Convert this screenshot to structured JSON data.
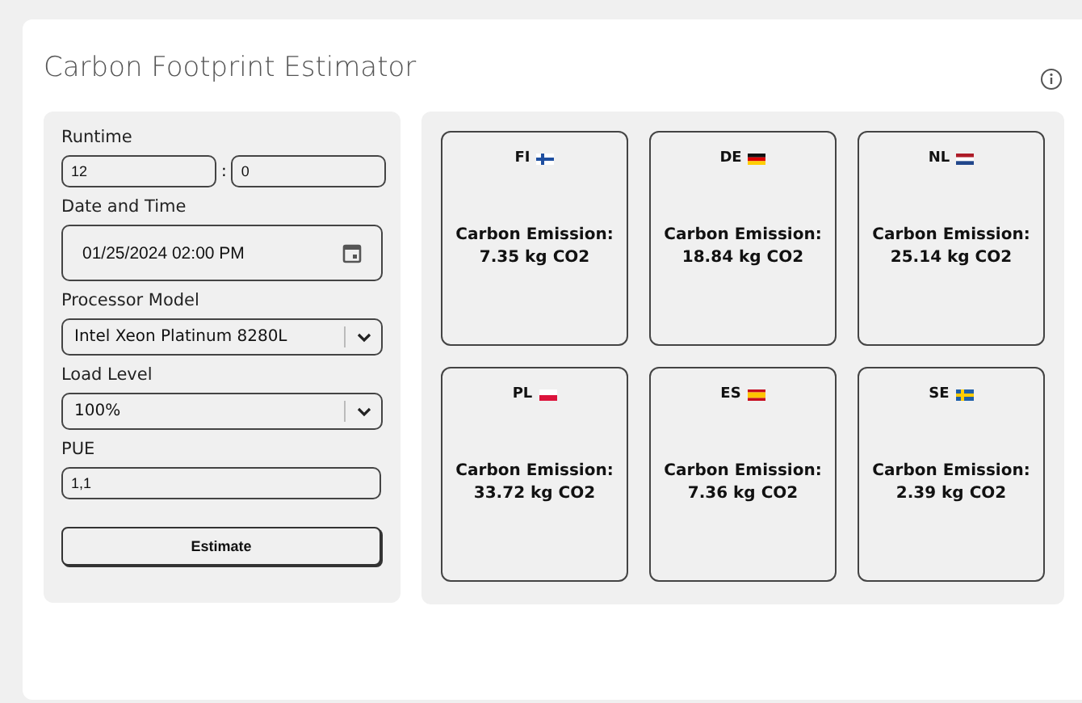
{
  "title": "Carbon Footprint Estimator",
  "form": {
    "runtime_label": "Runtime",
    "runtime_hours": "12",
    "runtime_separator": ":",
    "runtime_minutes": "0",
    "datetime_label": "Date and Time",
    "datetime": "01/25/2024 02:00 PM",
    "processor_label": "Processor Model",
    "processor": "Intel Xeon Platinum 8280L",
    "load_label": "Load Level",
    "load": "100%",
    "pue_label": "PUE",
    "pue": "1,1",
    "button": "Estimate"
  },
  "results": [
    {
      "country": "FI",
      "label": "Carbon Emission:",
      "value": "7.35 kg CO2"
    },
    {
      "country": "DE",
      "label": "Carbon Emission:",
      "value": "18.84 kg CO2"
    },
    {
      "country": "NL",
      "label": "Carbon Emission:",
      "value": "25.14 kg CO2"
    },
    {
      "country": "PL",
      "label": "Carbon Emission:",
      "value": "33.72 kg CO2"
    },
    {
      "country": "ES",
      "label": "Carbon Emission:",
      "value": "7.36 kg CO2"
    },
    {
      "country": "SE",
      "label": "Carbon Emission:",
      "value": "2.39 kg CO2"
    }
  ]
}
